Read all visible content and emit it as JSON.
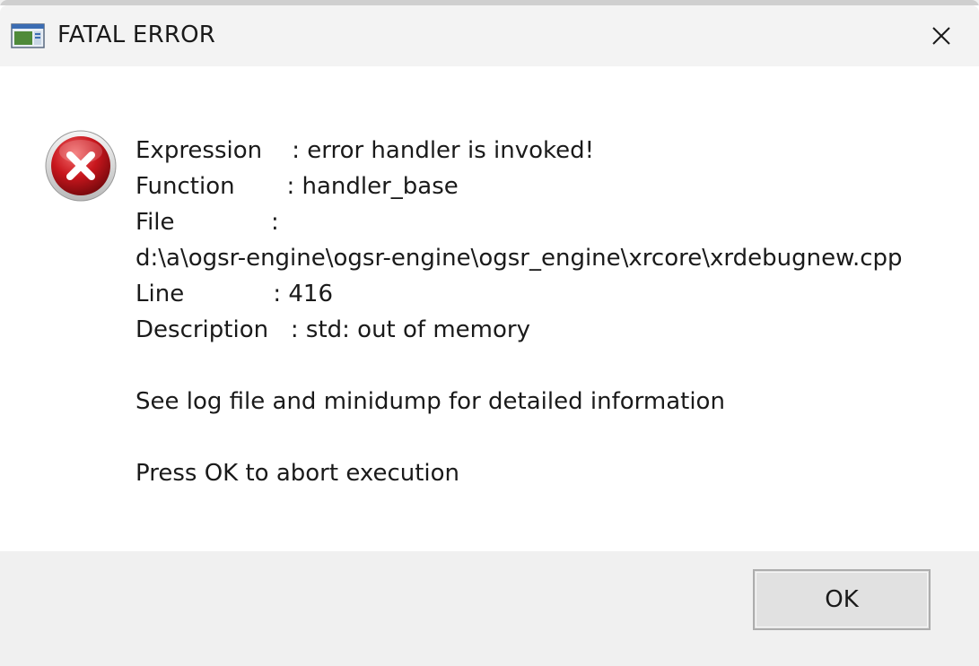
{
  "window": {
    "title": "FATAL ERROR",
    "app_icon": "app-window-icon",
    "close_icon": "close-icon"
  },
  "message": {
    "error_icon": "error-icon",
    "lines": [
      "Expression    : error handler is invoked!",
      "Function       : handler_base",
      "File             :",
      "d:\\a\\ogsr-engine\\ogsr-engine\\ogsr_engine\\xrcore\\xrdebugnew.cpp",
      "Line            : 416",
      "Description   : std: out of memory",
      "",
      "See log file and minidump for detailed information",
      "",
      "Press OK to abort execution"
    ]
  },
  "buttons": {
    "ok_label": "OK"
  },
  "colors": {
    "error_red": "#c8161d",
    "titlebar_bg": "#f3f3f3",
    "footer_bg": "#f0f0f0",
    "button_bg": "#e1e1e1",
    "button_border": "#adadad"
  }
}
